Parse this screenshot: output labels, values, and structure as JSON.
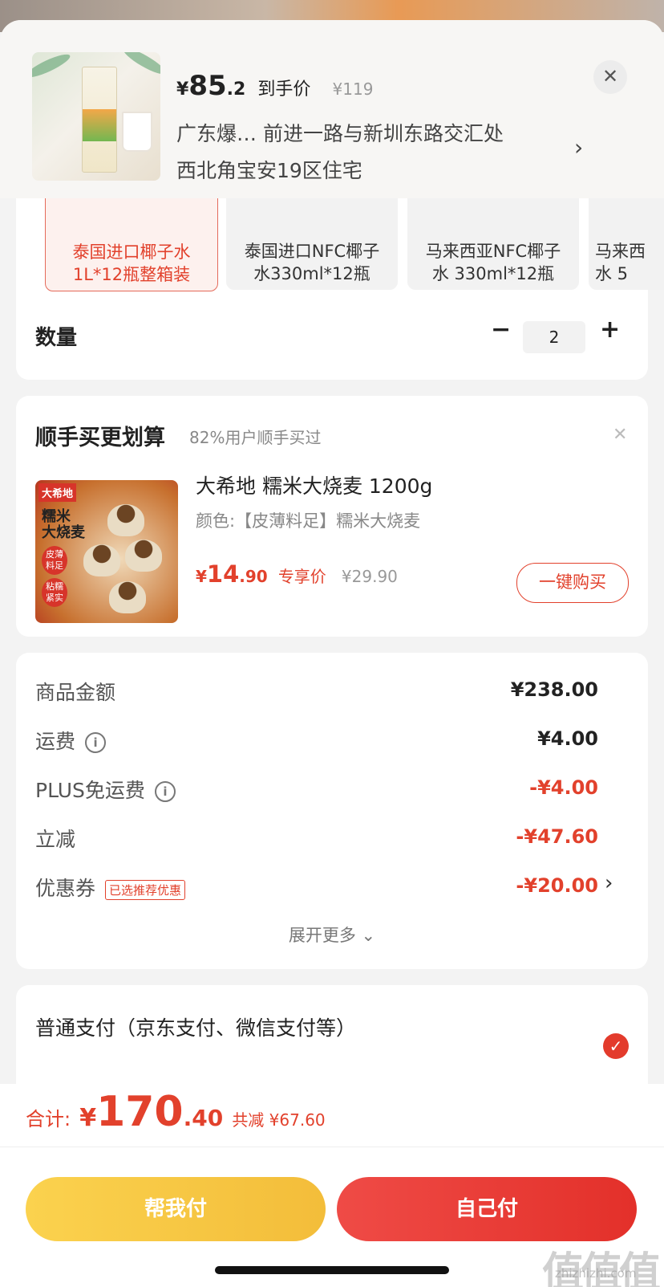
{
  "header": {
    "price_symbol": "¥",
    "price_int": "85",
    "price_dec": ".2",
    "price_label": "到手价",
    "original_price": "¥119",
    "address_line1": "广东爆…  前进一路与新圳东路交汇处",
    "address_line2": "西北角宝安19区住宅",
    "chevron": "›",
    "close": "✕"
  },
  "variants": [
    {
      "label_1": "泰国进口椰子水",
      "label_2": "1L*12瓶整箱装",
      "selected": true
    },
    {
      "label_1": "泰国进口NFC椰子",
      "label_2": "水330ml*12瓶",
      "selected": false
    },
    {
      "label_1": "马来西亚NFC椰子",
      "label_2": "水 330ml*12瓶",
      "selected": false
    },
    {
      "label_1": "马来西",
      "label_2": "水 5",
      "selected": false
    }
  ],
  "quantity": {
    "label": "数量",
    "minus": "−",
    "value": "2",
    "plus": "+"
  },
  "upsell": {
    "title": "顺手买更划算",
    "subtitle": "82%用户顺手买过",
    "close": "✕",
    "img_text_1": "大希地",
    "img_text_2": "糯米",
    "img_text_3": "大烧麦",
    "img_text_4": "皮薄",
    "img_text_5": "料足",
    "img_text_6": "粘糯",
    "img_text_7": "紧实",
    "product_name": "大希地 糯米大烧麦 1200g",
    "spec": "颜色:【皮薄料足】糯米大烧麦",
    "price_symbol": "¥",
    "price_int": "14",
    "price_dec": ".90",
    "price_label": "专享价",
    "original_price": "¥29.90",
    "buy_button": "一键购买"
  },
  "summary": {
    "rows": [
      {
        "label": "商品金额",
        "value": "¥238.00"
      },
      {
        "label": "运费",
        "value": "¥4.00"
      },
      {
        "label": "PLUS免运费",
        "value": "-¥4.00"
      },
      {
        "label": "立减",
        "value": "-¥47.60"
      },
      {
        "label": "优惠券",
        "tag": "已选推荐优惠",
        "value": "-¥20.00"
      }
    ],
    "info_icon": "i",
    "coupon_chevron": "›",
    "expand": "展开更多 ⌄"
  },
  "payment": {
    "method": "普通支付（京东支付、微信支付等）",
    "check": "✓"
  },
  "footer": {
    "total_label": "合计:",
    "total_symbol": "¥",
    "total_int": "170",
    "total_dec": ".40",
    "saved": "共减 ¥67.60",
    "help_pay": "帮我付",
    "self_pay": "自己付"
  },
  "watermark": {
    "text": "值值值",
    "site": "zhizhizhi.com"
  },
  "colors": {
    "accent_red": "#e2412c",
    "gold": "#f3bd3a"
  }
}
